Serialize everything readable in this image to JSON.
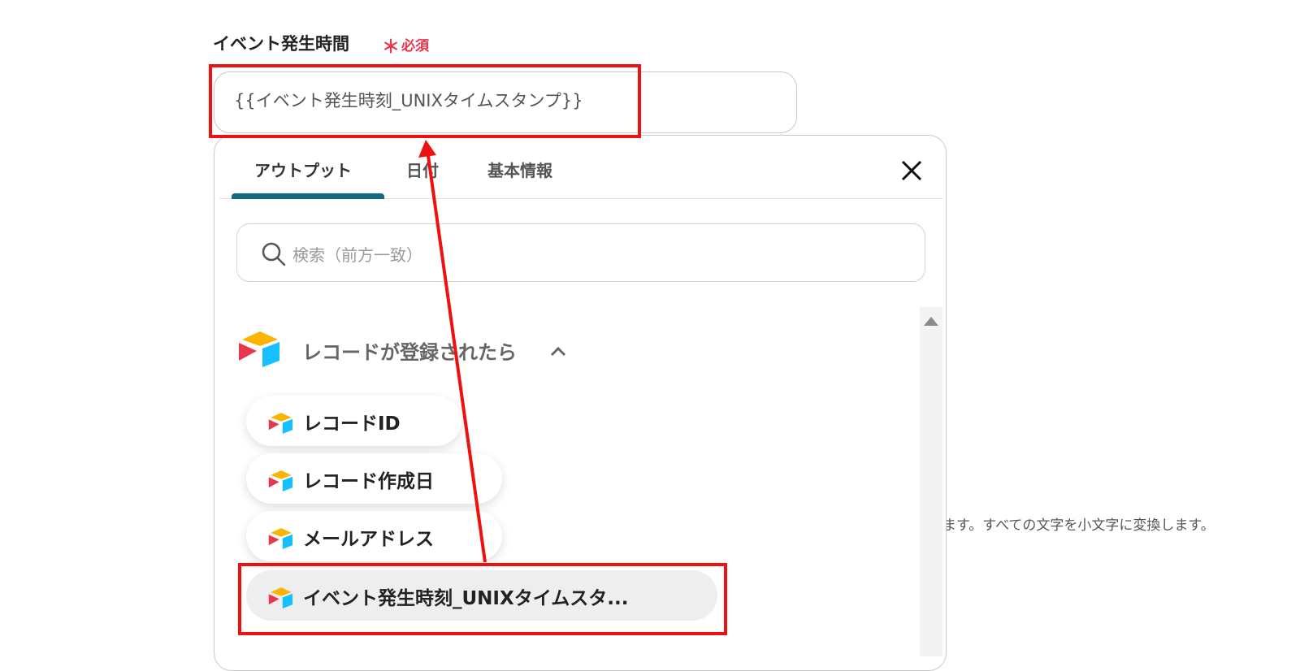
{
  "field": {
    "label": "イベント発生時間",
    "required_mark": "＊",
    "required_text": "必須",
    "value": "{{イベント発生時刻_UNIXタイムスタンプ}}"
  },
  "panel": {
    "tabs": [
      {
        "label": "アウトプット",
        "active": true
      },
      {
        "label": "日付",
        "active": false
      },
      {
        "label": "基本情報",
        "active": false
      }
    ],
    "close_icon": "close-icon",
    "search": {
      "placeholder": "検索（前方一致）",
      "icon": "search-icon"
    },
    "group": {
      "label": "レコードが登録されたら",
      "icon": "airtable-logo",
      "chevron": "chevron-up-icon"
    },
    "items": [
      {
        "label": "レコードID",
        "icon": "airtable-logo"
      },
      {
        "label": "レコード作成日",
        "icon": "airtable-logo"
      },
      {
        "label": "メールアドレス",
        "icon": "airtable-logo"
      },
      {
        "label": "イベント発生時刻_UNIXタイムスタ...",
        "icon": "airtable-logo",
        "selected": true
      }
    ]
  },
  "background_text": "ます。すべての文字を小文字に変換します。",
  "colors": {
    "required": "#e8364c",
    "tab_accent": "#126b7f",
    "highlight": "#ee1111",
    "logo_yellow": "#fcb400",
    "logo_blue": "#18bfff",
    "logo_red": "#e8364c"
  }
}
